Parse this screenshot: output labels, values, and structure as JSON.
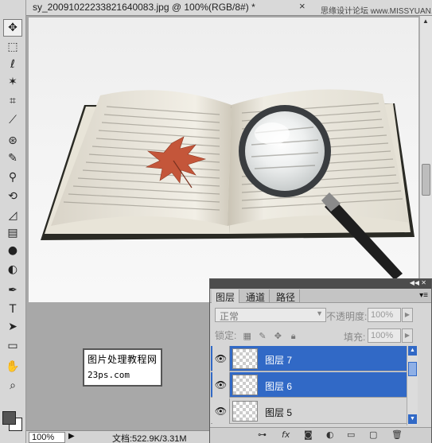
{
  "document": {
    "tab_title": "sy_20091022233821640083.jpg @ 100%(RGB/8#)",
    "modified_marker": "*",
    "close_glyph": "×",
    "watermark": "思缘设计论坛  www.MISSYUAN.COM"
  },
  "toolbar": {
    "tools": [
      {
        "name": "move-icon",
        "glyph": "✥"
      },
      {
        "name": "marquee-icon",
        "glyph": "⬚"
      },
      {
        "name": "lasso-icon",
        "glyph": "ℓ"
      },
      {
        "name": "magic-wand-icon",
        "glyph": "✶"
      },
      {
        "name": "crop-icon",
        "glyph": "⌗"
      },
      {
        "name": "eyedropper-icon",
        "glyph": "⟋"
      },
      {
        "name": "healing-brush-icon",
        "glyph": "⊛"
      },
      {
        "name": "brush-icon",
        "glyph": "✎"
      },
      {
        "name": "clone-stamp-icon",
        "glyph": "⚲"
      },
      {
        "name": "history-brush-icon",
        "glyph": "⟲"
      },
      {
        "name": "eraser-icon",
        "glyph": "◿"
      },
      {
        "name": "gradient-icon",
        "glyph": "▤"
      },
      {
        "name": "blur-icon",
        "glyph": "●"
      },
      {
        "name": "dodge-icon",
        "glyph": "◐"
      },
      {
        "name": "pen-icon",
        "glyph": "✒"
      },
      {
        "name": "type-icon",
        "glyph": "T"
      },
      {
        "name": "path-selection-icon",
        "glyph": "➤"
      },
      {
        "name": "shape-icon",
        "glyph": "▭"
      },
      {
        "name": "hand-icon",
        "glyph": "✋"
      },
      {
        "name": "zoom-icon",
        "glyph": "⌕"
      }
    ]
  },
  "status": {
    "zoom": "100%",
    "doc_info": "文档:522.9K/3.31M"
  },
  "logo": {
    "line1": "图片处理教程网",
    "line2": "23ps.com"
  },
  "layers_panel": {
    "tabs": [
      "图层",
      "通道",
      "路径"
    ],
    "blend_mode": "正常",
    "opacity_label": "不透明度:",
    "opacity_value": "100%",
    "lock_label": "锁定:",
    "fill_label": "填充:",
    "fill_value": "100%",
    "layers": [
      {
        "name": "图层 7",
        "selected": true
      },
      {
        "name": "图层 6",
        "selected": true
      },
      {
        "name": "图层 5",
        "selected": false
      }
    ],
    "footer_icons": [
      "link-icon",
      "fx-icon",
      "mask-icon",
      "adjustment-icon",
      "group-icon",
      "new-layer-icon",
      "trash-icon"
    ]
  },
  "colors": {
    "selection": "#3169c6",
    "panel_bg": "#d6d6d6",
    "leaf": "#c4563a"
  }
}
